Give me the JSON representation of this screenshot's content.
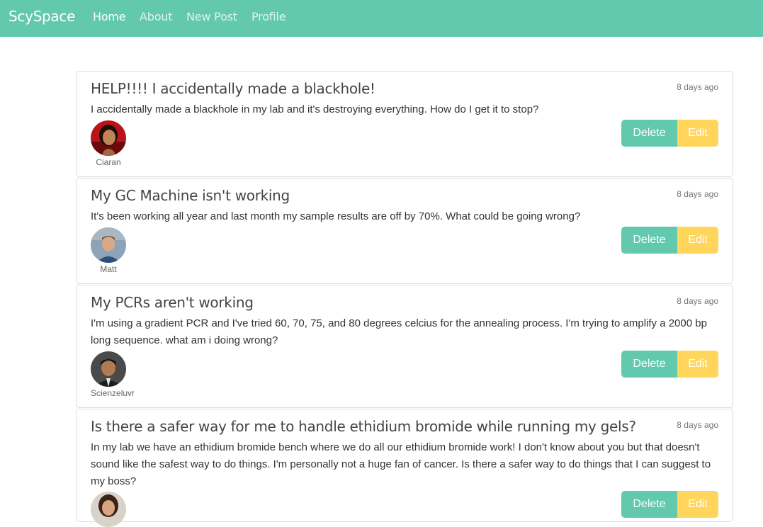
{
  "navbar": {
    "brand": "ScySpace",
    "links": [
      {
        "label": "Home",
        "active": true
      },
      {
        "label": "About",
        "active": false
      },
      {
        "label": "New Post",
        "active": false
      },
      {
        "label": "Profile",
        "active": false
      }
    ]
  },
  "posts": [
    {
      "title": "HELP!!!! I accidentally made a blackhole!",
      "time": "8 days ago",
      "body": "I accidentally made a blackhole in my lab and it's destroying everything. How do I get it to stop?",
      "author": "Ciaran",
      "delete_label": "Delete",
      "edit_label": "Edit"
    },
    {
      "title": "My GC Machine isn't working",
      "time": "8 days ago",
      "body": "It's been working all year and last month my sample results are off by 70%. What could be going wrong?",
      "author": "Matt",
      "delete_label": "Delete",
      "edit_label": "Edit"
    },
    {
      "title": "My PCRs aren't working",
      "time": "8 days ago",
      "body": "I'm using a gradient PCR and I've tried 60, 70, 75, and 80 degrees celcius for the annealing process. I'm trying to amplify a 2000 bp long sequence. what am i doing wrong?",
      "author": "Scienzeluvr",
      "delete_label": "Delete",
      "edit_label": "Edit"
    },
    {
      "title": "Is there a safer way for me to handle ethidium bromide while running my gels?",
      "time": "8 days ago",
      "body": "In my lab we have an ethidium bromide bench where we do all our ethidium bromide work! I don't know about you but that doesn't sound like the safest way to do things. I'm personally not a huge fan of cancer. Is there a safer way to do things that I can suggest to my boss?",
      "author": "",
      "delete_label": "Delete",
      "edit_label": "Edit"
    }
  ],
  "colors": {
    "navbar": "#62c9ae",
    "delete_button": "#62c9ae",
    "edit_button": "#ffd55c"
  }
}
